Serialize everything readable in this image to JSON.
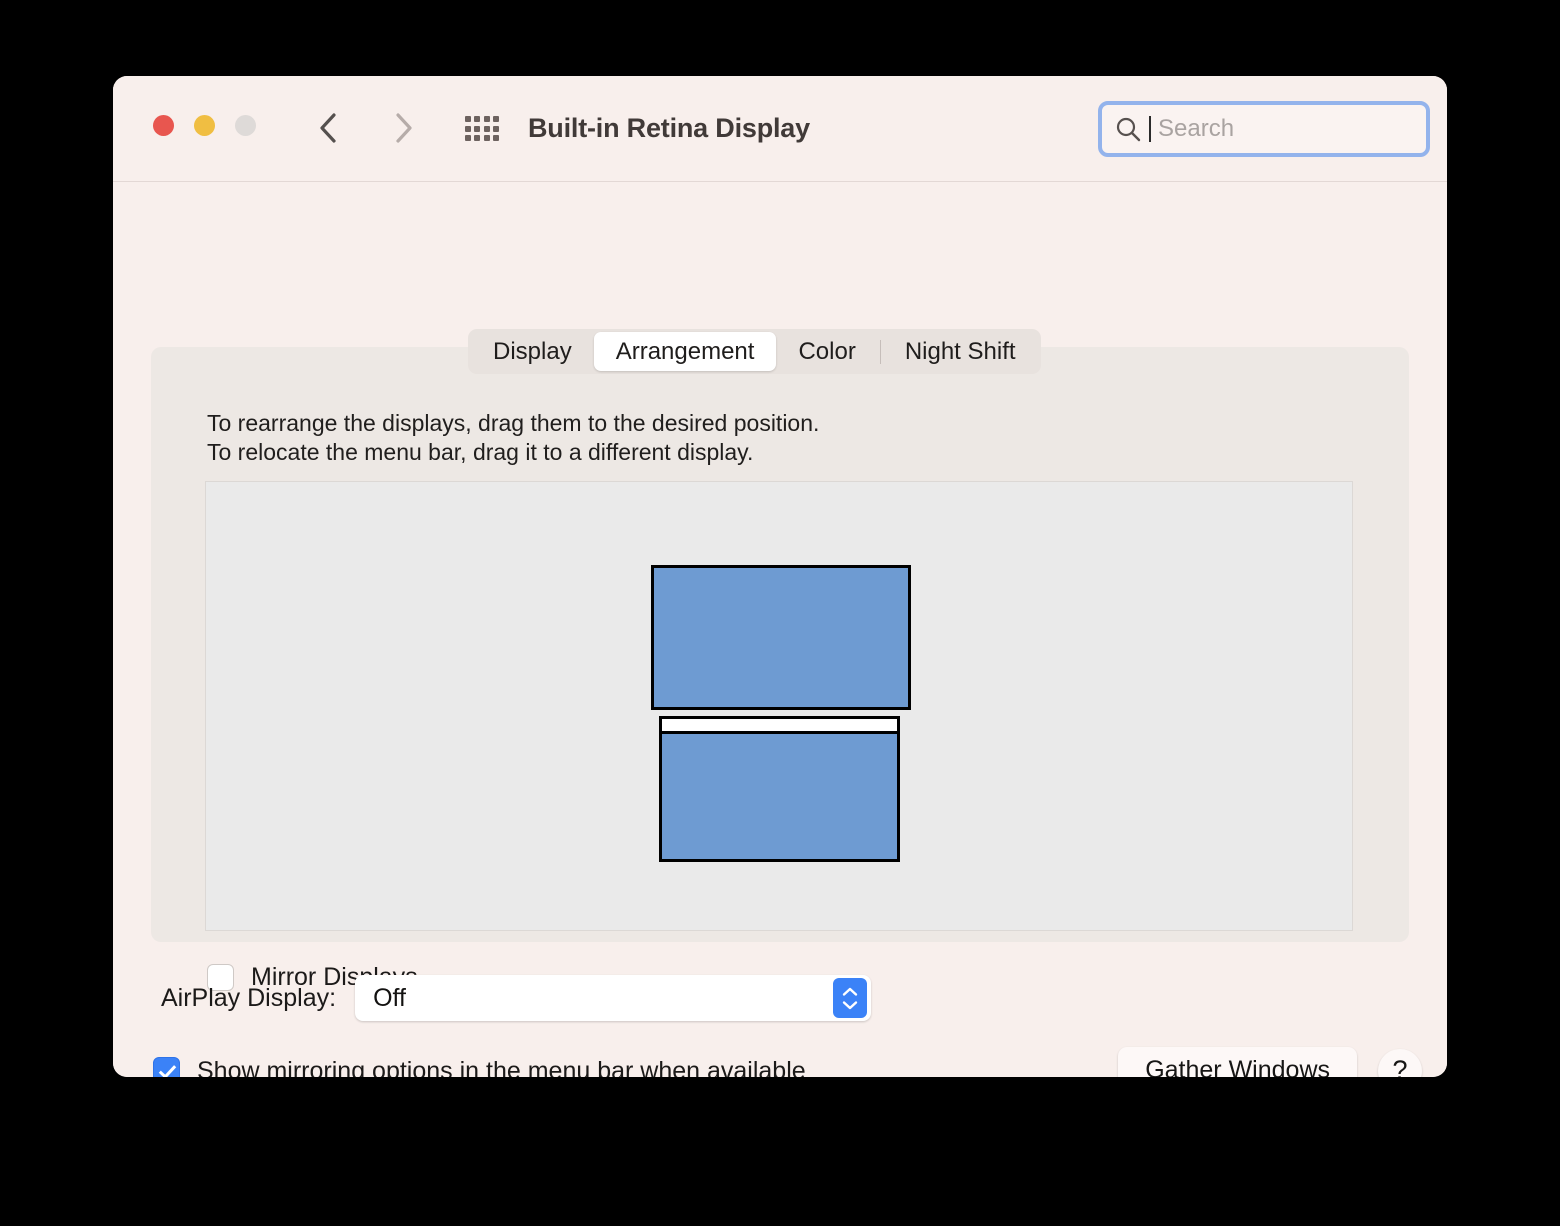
{
  "window": {
    "title": "Built-in Retina Display",
    "traffic_lights": [
      {
        "name": "close",
        "color": "#E8564F"
      },
      {
        "name": "minimize",
        "color": "#F0BE42"
      },
      {
        "name": "zoom",
        "color": "#DEDAD8"
      }
    ],
    "nav": {
      "back": "‹",
      "forward": "›"
    },
    "grid_icon": "show-all-icon"
  },
  "search": {
    "placeholder": "Search",
    "value": "",
    "icon": "search-icon",
    "focus_ring_color": "#93B3EC"
  },
  "tabs": [
    {
      "label": "Display",
      "selected": false
    },
    {
      "label": "Arrangement",
      "selected": true
    },
    {
      "label": "Color",
      "selected": false
    },
    {
      "label": "Night Shift",
      "selected": false
    }
  ],
  "instructions": {
    "line1": "To rearrange the displays, drag them to the desired position.",
    "line2": "To relocate the menu bar, drag it to a different display."
  },
  "arrangement": {
    "display_color": "#6E9BD2",
    "displays": [
      {
        "name": "display-1",
        "has_menu_bar": false
      },
      {
        "name": "display-2",
        "has_menu_bar": true
      }
    ]
  },
  "mirror": {
    "label": "Mirror Displays",
    "checked": false
  },
  "airplay": {
    "label": "AirPlay Display:",
    "value": "Off",
    "accent_color": "#3B82F7"
  },
  "mirroring_options": {
    "label": "Show mirroring options in the menu bar when available",
    "checked": true
  },
  "buttons": {
    "gather_windows": "Gather Windows",
    "help": "?"
  }
}
